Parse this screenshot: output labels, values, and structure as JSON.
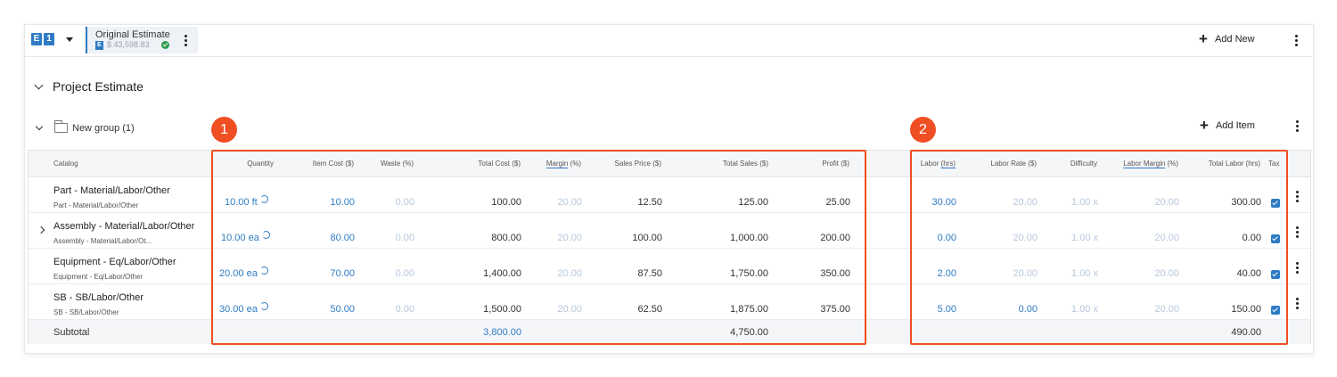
{
  "topbar": {
    "badge_letters": [
      "E",
      "1"
    ],
    "estimate_title": "Original Estimate",
    "estimate_badge": "E",
    "estimate_amount": "$ 43,598.83",
    "add_new_label": "Add New"
  },
  "section": {
    "title": "Project Estimate"
  },
  "group": {
    "title": "New group (1)",
    "add_item_label": "Add Item"
  },
  "columns": {
    "catalog": "Catalog",
    "quantity": "Quantity",
    "item_cost": "Item Cost ($)",
    "waste": "Waste (%)",
    "total_cost": "Total Cost ($)",
    "margin_a": "Margin",
    "margin_b": " (%)",
    "sales_price": "Sales Price ($)",
    "total_sales": "Total Sales ($)",
    "profit": "Profit ($)",
    "labor_a": "Labor ",
    "labor_b": "(hrs)",
    "labor_rate": "Labor Rate ($)",
    "difficulty": "Difficulty",
    "labor_margin_a": "Labor Margin",
    "labor_margin_b": " (%)",
    "total_labor": "Total Labor (hrs)",
    "tax": "Tax"
  },
  "rows": [
    {
      "name": "Part - Material/Labor/Other",
      "sub": "Part - Material/Labor/Other",
      "quantity": "10.00 ft",
      "item_cost": "10.00",
      "waste": "0.00",
      "total_cost": "100.00",
      "margin": "20.00",
      "sales_price": "12.50",
      "total_sales": "125.00",
      "profit": "25.00",
      "labor": "30.00",
      "labor_rate": "20.00",
      "difficulty": "1.00 x",
      "labor_margin": "20.00",
      "total_labor": "300.00"
    },
    {
      "name": "Assembly - Material/Labor/Other",
      "sub": "Assembly - Material/Labor/Ot...",
      "quantity": "10.00 ea",
      "item_cost": "80.00",
      "waste": "0.00",
      "total_cost": "800.00",
      "margin": "20.00",
      "sales_price": "100.00",
      "total_sales": "1,000.00",
      "profit": "200.00",
      "labor": "0.00",
      "labor_rate": "20.00",
      "difficulty": "1.00 x",
      "labor_margin": "20.00",
      "total_labor": "0.00"
    },
    {
      "name": "Equipment - Eq/Labor/Other",
      "sub": "Equipment - Eq/Labor/Other",
      "quantity": "20.00 ea",
      "item_cost": "70.00",
      "waste": "0.00",
      "total_cost": "1,400.00",
      "margin": "20.00",
      "sales_price": "87.50",
      "total_sales": "1,750.00",
      "profit": "350.00",
      "labor": "2.00",
      "labor_rate": "20.00",
      "difficulty": "1.00 x",
      "labor_margin": "20.00",
      "total_labor": "40.00"
    },
    {
      "name": "SB - SB/Labor/Other",
      "sub": "SB - SB/Labor/Other",
      "quantity": "30.00 ea",
      "item_cost": "50.00",
      "waste": "0.00",
      "total_cost": "1,500.00",
      "margin": "20.00",
      "sales_price": "62.50",
      "total_sales": "1,875.00",
      "profit": "375.00",
      "labor": "5.00",
      "labor_rate": "0.00",
      "difficulty": "1.00 x",
      "labor_margin": "20.00",
      "total_labor": "150.00"
    }
  ],
  "subtotal": {
    "label": "Subtotal",
    "total_cost": "3,800.00",
    "total_sales": "4,750.00",
    "total_labor": "490.00"
  },
  "callouts": [
    "1",
    "2"
  ],
  "colors": {
    "accent": "#2e7bc4",
    "highlight": "#f04e23",
    "check": "#2e9b4e"
  }
}
